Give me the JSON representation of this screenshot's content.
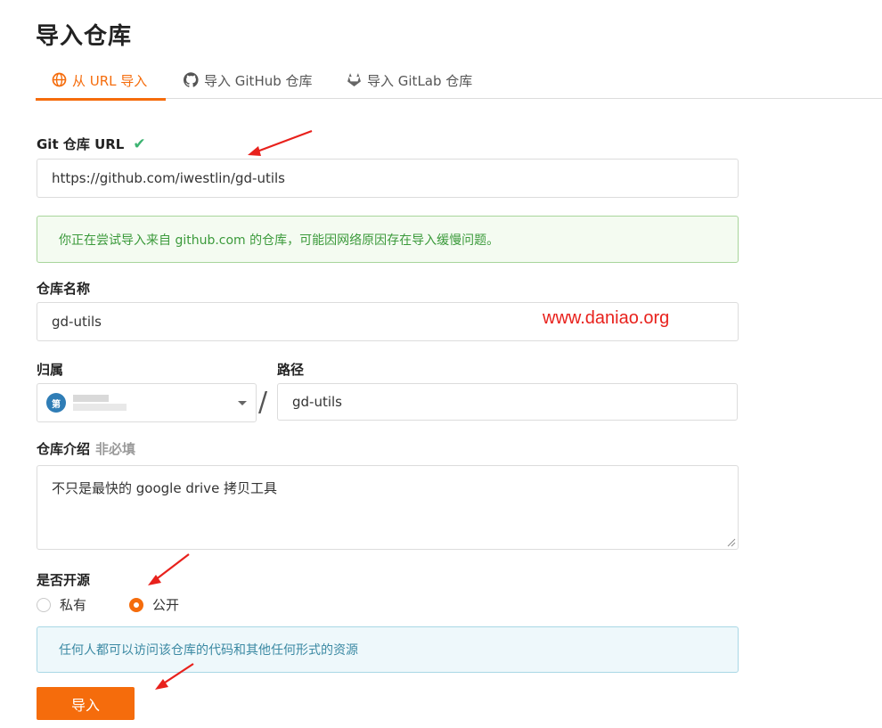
{
  "page": {
    "title": "导入仓库"
  },
  "tabs": [
    {
      "label": "从 URL 导入",
      "icon": "globe-icon",
      "active": true
    },
    {
      "label": "导入 GitHub 仓库",
      "icon": "github-icon",
      "active": false
    },
    {
      "label": "导入 GitLab 仓库",
      "icon": "gitlab-icon",
      "active": false
    }
  ],
  "form": {
    "git_url": {
      "label": "Git 仓库 URL",
      "value": "https://github.com/iwestlin/gd-utils",
      "valid_icon": "check-icon"
    },
    "notice": "你正在尝试导入来自 github.com 的仓库，可能因网络原因存在导入缓慢问题。",
    "repo_name": {
      "label": "仓库名称",
      "value": "gd-utils"
    },
    "owner": {
      "label": "归属",
      "avatar_text": "第"
    },
    "separator": "/",
    "path": {
      "label": "路径",
      "value": "gd-utils"
    },
    "description": {
      "label": "仓库介绍",
      "optional": "非必填",
      "value": "不只是最快的 google drive 拷贝工具"
    },
    "visibility": {
      "label": "是否开源",
      "options": [
        {
          "label": "私有",
          "checked": false
        },
        {
          "label": "公开",
          "checked": true
        }
      ],
      "info": "任何人都可以访问该仓库的代码和其他任何形式的资源"
    },
    "submit": "导入"
  },
  "watermark": "www.daniao.org",
  "colors": {
    "accent": "#f56c0c",
    "success": "#3cb371",
    "annotation_red": "#e8211c"
  }
}
